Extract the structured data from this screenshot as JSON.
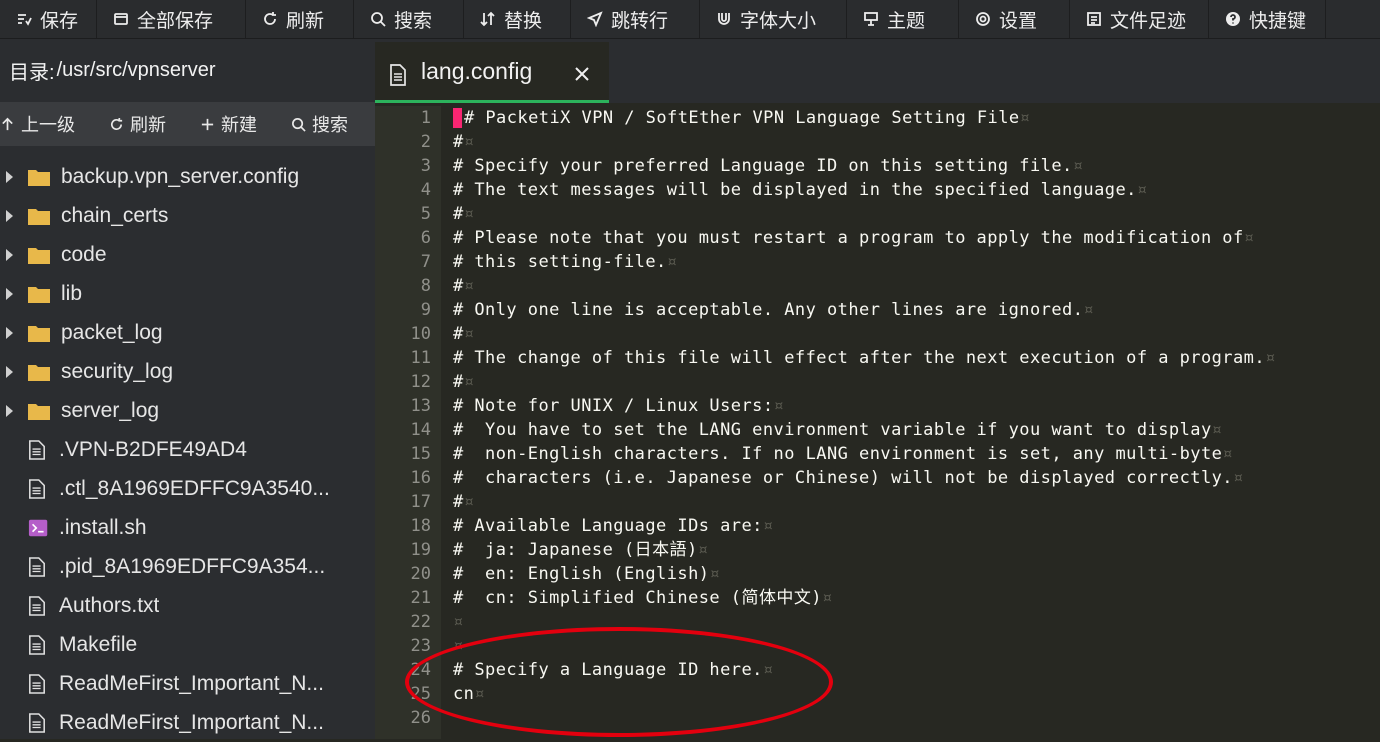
{
  "toolbar": {
    "items": [
      {
        "label": "保存",
        "icon": "save-icon"
      },
      {
        "label": "全部保存",
        "icon": "save-all-icon"
      },
      {
        "label": "刷新",
        "icon": "refresh-icon"
      },
      {
        "label": "搜索",
        "icon": "search-icon"
      },
      {
        "label": "替换",
        "icon": "replace-icon"
      },
      {
        "label": "跳转行",
        "icon": "goto-line-icon"
      },
      {
        "label": "字体大小",
        "icon": "font-size-icon"
      },
      {
        "label": "主题",
        "icon": "theme-icon"
      },
      {
        "label": "设置",
        "icon": "gear-icon"
      },
      {
        "label": "文件足迹",
        "icon": "history-icon"
      },
      {
        "label": "快捷键",
        "icon": "help-icon"
      }
    ]
  },
  "sidebar": {
    "dir_label": "目录:",
    "dir_path": "/usr/src/vpnserver",
    "actions": {
      "up": "上一级",
      "refresh": "刷新",
      "new": "新建",
      "search": "搜索"
    },
    "items": [
      {
        "name": "backup.vpn_server.config",
        "type": "folder"
      },
      {
        "name": "chain_certs",
        "type": "folder"
      },
      {
        "name": "code",
        "type": "folder"
      },
      {
        "name": "lib",
        "type": "folder"
      },
      {
        "name": "packet_log",
        "type": "folder"
      },
      {
        "name": "security_log",
        "type": "folder"
      },
      {
        "name": "server_log",
        "type": "folder"
      },
      {
        "name": ".VPN-B2DFE49AD4",
        "type": "file"
      },
      {
        "name": ".ctl_8A1969EDFFC9A3540...",
        "type": "file"
      },
      {
        "name": ".install.sh",
        "type": "script"
      },
      {
        "name": ".pid_8A1969EDFFC9A354...",
        "type": "file"
      },
      {
        "name": "Authors.txt",
        "type": "file"
      },
      {
        "name": "Makefile",
        "type": "file"
      },
      {
        "name": "ReadMeFirst_Important_N...",
        "type": "file"
      },
      {
        "name": "ReadMeFirst_Important_N...",
        "type": "file"
      }
    ]
  },
  "editor": {
    "tab_name": "lang.config",
    "eol_marker": "¤",
    "lines": [
      "# PacketiX VPN / SoftEther VPN Language Setting File",
      "#",
      "# Specify your preferred Language ID on this setting file.",
      "# The text messages will be displayed in the specified language.",
      "#",
      "# Please note that you must restart a program to apply the modification of",
      "# this setting-file.",
      "#",
      "# Only one line is acceptable. Any other lines are ignored.",
      "#",
      "# The change of this file will effect after the next execution of a program.",
      "#",
      "# Note for UNIX / Linux Users:",
      "#  You have to set the LANG environment variable if you want to display",
      "#  non-English characters. If no LANG environment is set, any multi-byte",
      "#  characters (i.e. Japanese or Chinese) will not be displayed correctly.",
      "#",
      "# Available Language IDs are:",
      "#  ja: Japanese (日本語)",
      "#  en: English (English)",
      "#  cn: Simplified Chinese (简体中文)",
      "",
      "",
      "# Specify a Language ID here.",
      "cn",
      ""
    ]
  },
  "colors": {
    "accent": "#2cb35c",
    "cursor": "#f92672",
    "annotation": "#e3000e",
    "folder": "#e8b84a",
    "script": "#b55ec9"
  }
}
